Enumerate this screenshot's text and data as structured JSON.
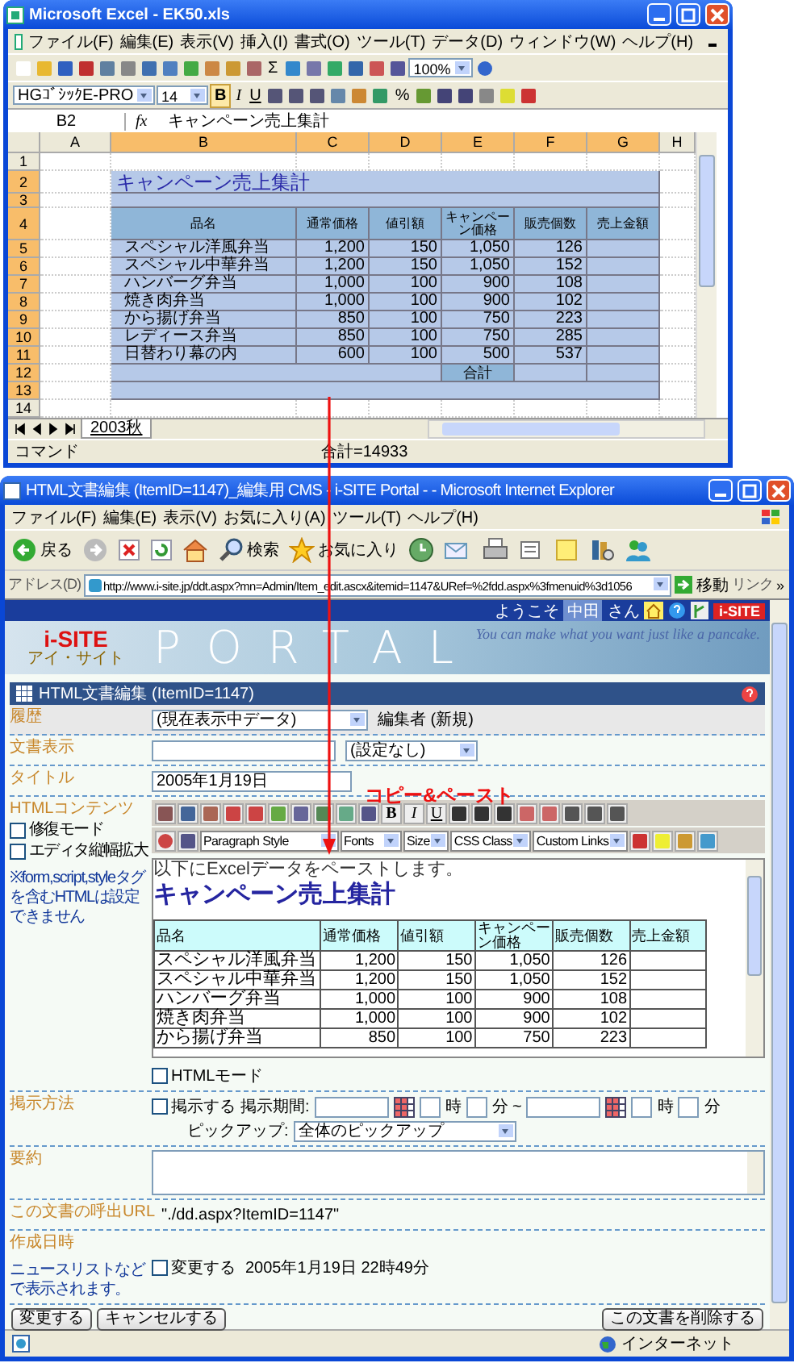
{
  "excel": {
    "title": "Microsoft Excel - EK50.xls",
    "menu": [
      "ファイル(F)",
      "編集(E)",
      "表示(V)",
      "挿入(I)",
      "書式(O)",
      "ツール(T)",
      "データ(D)",
      "ウィンドウ(W)",
      "ヘルプ(H)"
    ],
    "sum_symbol": "Σ",
    "zoom": "100%",
    "font_name": "HGｺﾞｼｯｸE-PRO",
    "font_size": "14",
    "bold": {
      "label": "B",
      "pressed": true
    },
    "italic": "I",
    "underline": "U",
    "percent": "%",
    "name_box": "B2",
    "fx": "fx",
    "formula": "キャンペーン売上集計",
    "columns": [
      {
        "label": "A",
        "selected": false
      },
      {
        "label": "B",
        "selected": true
      },
      {
        "label": "C",
        "selected": true
      },
      {
        "label": "D",
        "selected": true
      },
      {
        "label": "E",
        "selected": true
      },
      {
        "label": "F",
        "selected": true
      },
      {
        "label": "G",
        "selected": true
      },
      {
        "label": "H",
        "selected": false
      }
    ],
    "rows": [
      {
        "label": "1",
        "selected": false
      },
      {
        "label": "2",
        "selected": true
      },
      {
        "label": "3",
        "selected": true
      },
      {
        "label": "4",
        "selected": true
      },
      {
        "label": "5",
        "selected": true
      },
      {
        "label": "6",
        "selected": true
      },
      {
        "label": "7",
        "selected": true
      },
      {
        "label": "8",
        "selected": true
      },
      {
        "label": "9",
        "selected": true
      },
      {
        "label": "10",
        "selected": true
      },
      {
        "label": "11",
        "selected": true
      },
      {
        "label": "12",
        "selected": true
      },
      {
        "label": "13",
        "selected": true
      },
      {
        "label": "14",
        "selected": false
      }
    ],
    "table": {
      "title": "キャンペーン売上集計",
      "columns": [
        "品名",
        "通常価格",
        "値引額",
        "キャンペーン価格",
        "販売個数",
        "売上金額"
      ],
      "rows": [
        [
          "スペシャル洋風弁当",
          "1,200",
          "150",
          "1,050",
          "126"
        ],
        [
          "スペシャル中華弁当",
          "1,200",
          "150",
          "1,050",
          "152"
        ],
        [
          "ハンバーグ弁当",
          "1,000",
          "100",
          "900",
          "108"
        ],
        [
          "焼き肉弁当",
          "1,000",
          "100",
          "900",
          "102"
        ],
        [
          "から揚げ弁当",
          "850",
          "100",
          "750",
          "223"
        ],
        [
          "レディース弁当",
          "850",
          "100",
          "750",
          "285"
        ],
        [
          "日替わり幕の内",
          "600",
          "100",
          "500",
          "537"
        ]
      ],
      "total_label": "合計"
    },
    "sheet_tab": {
      "label": "2003秋",
      "selected": true
    },
    "status_left": "コマンド",
    "status_sum": "合計=14933"
  },
  "annotation": "コピー&ペースト",
  "ie": {
    "title": "HTML文書編集 (ItemID=1147)_編集用 CMS - i-SITE Portal - - Microsoft Internet Explorer",
    "menu": [
      "ファイル(F)",
      "編集(E)",
      "表示(V)",
      "お気に入り(A)",
      "ツール(T)",
      "ヘルプ(H)"
    ],
    "back_label": "戻る",
    "search_label": "検索",
    "favorites_label": "お気に入り",
    "address_label": "アドレス(D)",
    "url": "http://www.i-site.jp/ddt.aspx?mn=Admin/Item_edit.ascx&itemid=1147&URef=%2fdd.aspx%3fmenuid%3d1056",
    "go_label": "移動",
    "links_label": "リンク",
    "more": "»",
    "welcome": "ようこそ",
    "user": "中田",
    "honorific": "さん",
    "site_badge": "i-SITE",
    "banner": {
      "logo": "i-SITE",
      "logo_kana": "アイ・サイト",
      "title": "PORTAL",
      "tagline": "You can make what you want just like a pancake."
    },
    "panel_title": "HTML文書編集 (ItemID=1147)",
    "history": {
      "label": "履歴",
      "value": "(現在表示中データ)",
      "editor": "編集者 (新規)"
    },
    "display": {
      "label": "文書表示",
      "value": "(設定なし)"
    },
    "title_field": {
      "label": "タイトル",
      "value": "2005年1月19日"
    },
    "content": {
      "label": "HTMLコンテンツ",
      "options": [
        {
          "label": "修復モード",
          "checked": false
        },
        {
          "label": "エディタ縦幅拡大",
          "checked": false
        }
      ],
      "note": "※form,script,styleタグを含むHTMLは設定できません",
      "toolbar_selects": [
        "Paragraph Style",
        "Fonts",
        "Size",
        "CSS Class",
        "Custom Links"
      ],
      "bold": "B",
      "italic": "I",
      "underline": "U",
      "intro": "以下にExcelデータをペーストします。",
      "heading": "キャンペーン売上集計",
      "table_columns": [
        "品名",
        "通常価格",
        "値引額",
        "キャンペーン価格",
        "販売個数",
        "売上金額"
      ],
      "table_rows": [
        [
          "スペシャル洋風弁当",
          "1,200",
          "150",
          "1,050",
          "126"
        ],
        [
          "スペシャル中華弁当",
          "1,200",
          "150",
          "1,050",
          "152"
        ],
        [
          "ハンバーグ弁当",
          "1,000",
          "100",
          "900",
          "108"
        ],
        [
          "焼き肉弁当",
          "1,000",
          "100",
          "900",
          "102"
        ],
        [
          "から揚げ弁当",
          "850",
          "100",
          "750",
          "223"
        ]
      ],
      "html_mode": {
        "label": "HTMLモード",
        "checked": false
      }
    },
    "publish": {
      "label": "掲示方法",
      "enable": {
        "label": "掲示する",
        "checked": false
      },
      "period_label": "掲示期間:",
      "start_hour": "時",
      "start_minute": "分 ~",
      "end_hour": "時",
      "end_minute": "分",
      "pickup_label": "ピックアップ:",
      "pickup_value": "全体のピックアップ"
    },
    "summary": {
      "label": "要約"
    },
    "url_row": {
      "label": "この文書の呼出URL",
      "value": "\"./dd.aspx?ItemID=1147\""
    },
    "created": {
      "label": "作成日時",
      "note": "ニュースリストなどで表示されます。",
      "change": {
        "label": "変更する",
        "checked": false
      },
      "value": "2005年1月19日 22時49分"
    },
    "buttons": {
      "save": "変更する",
      "cancel": "キャンセルする",
      "delete": "この文書を削除する"
    },
    "status": "インターネット"
  }
}
